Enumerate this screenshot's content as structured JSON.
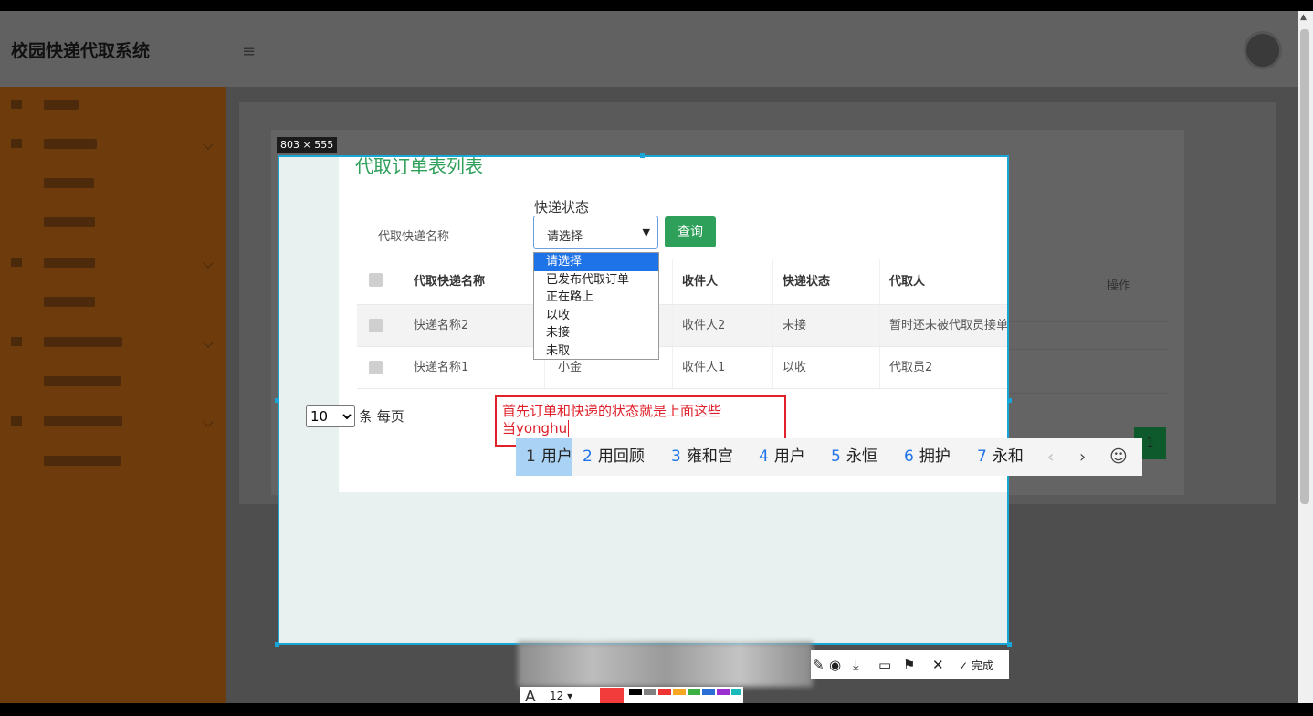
{
  "app": {
    "title": "校园快递代取系统",
    "menu_toggle_icon": "≡"
  },
  "capture": {
    "size_label": "803 × 555"
  },
  "page": {
    "title": "代取订单表列表",
    "filter": {
      "status_label": "快递状态",
      "name_label": "代取快递名称",
      "status_select_value": "请选择",
      "query_button": "查询"
    },
    "dropdown_options": [
      "请选择",
      "已发布代取订单",
      "正在路上",
      "以收",
      "未接",
      "未取"
    ],
    "table": {
      "headers": [
        "代取快递名称",
        "收件人",
        "快递状态",
        "代取人"
      ],
      "rows": [
        {
          "name": "快递名称2",
          "recipient": "收件人2",
          "status": "未接",
          "agent": "暂时还未被代取员接单"
        },
        {
          "name": "快递名称1",
          "col2": "小金",
          "recipient": "收件人1",
          "status": "以收",
          "agent": "代取员2"
        }
      ],
      "bg_action_header": "操作"
    },
    "pagination": {
      "per_page_value": "10",
      "per_page_suffix": "条 每页",
      "current_page": "1"
    }
  },
  "annotation": {
    "line1": "首先订单和快递的状态就是上面这些",
    "line2": "当yonghu"
  },
  "ime": {
    "candidates": [
      {
        "n": "1",
        "text": "用户"
      },
      {
        "n": "2",
        "text": "用回顾"
      },
      {
        "n": "3",
        "text": "雍和宫"
      },
      {
        "n": "4",
        "text": "用户"
      },
      {
        "n": "5",
        "text": "永恒"
      },
      {
        "n": "6",
        "text": "拥护"
      },
      {
        "n": "7",
        "text": "永和"
      }
    ],
    "prev": "‹",
    "next": "›",
    "emoji": "☺"
  },
  "screenshot_toolbar": {
    "done_label": "完成",
    "font_size": "12"
  },
  "colors": {
    "accent_green": "#2ea05a",
    "sidebar": "#6e3b0c",
    "selection_blue": "#18a6d7",
    "annotation_red": "#e0202a"
  }
}
